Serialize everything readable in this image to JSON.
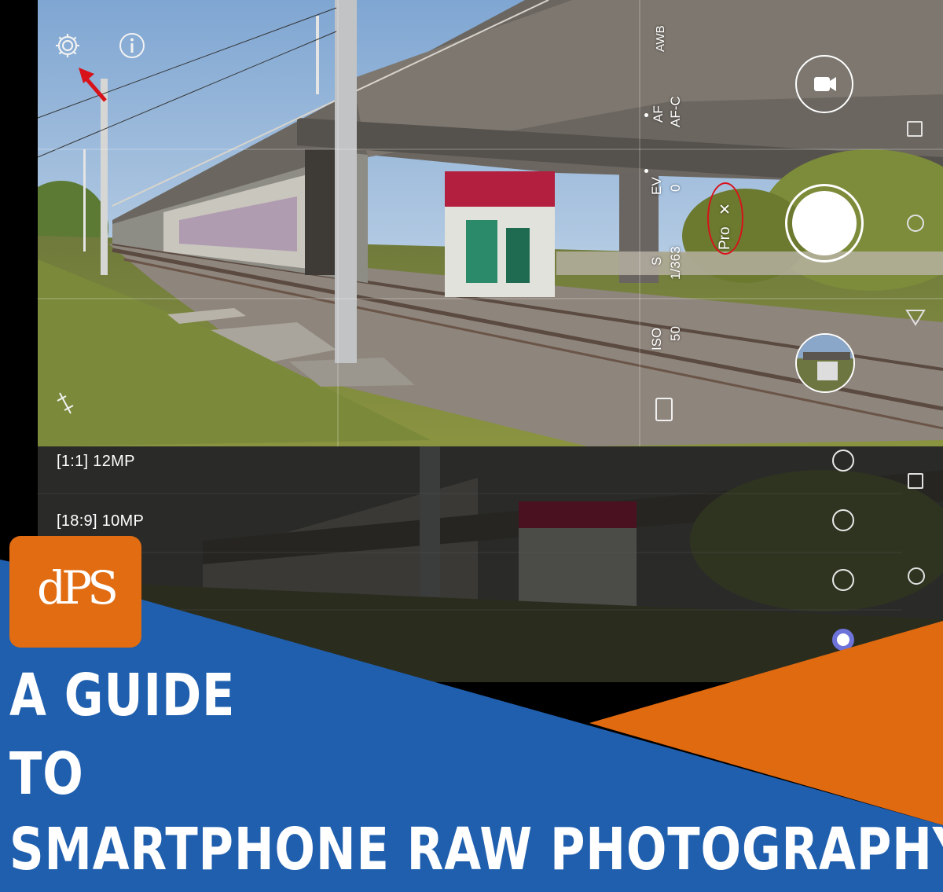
{
  "camera": {
    "settings_icon": "gear-icon",
    "info_icon": "info-icon",
    "annotation_arrow_color": "#d8121a",
    "white_balance": "AWB",
    "af_label": "AF",
    "af_value": "AF-C",
    "ev_label": "EV",
    "ev_value": "0",
    "s_label": "S",
    "s_value": "1/363",
    "iso_label": "ISO",
    "iso_value": "50",
    "mode_label": "Pro",
    "mode_close": "✕",
    "video_icon": "video-camera-icon",
    "shutter_icon": "shutter-button",
    "grid_icon": "leveler-icon"
  },
  "resolution": {
    "options": [
      {
        "label": "[1:1] 12MP",
        "selected": false
      },
      {
        "label": "[18:9] 10MP",
        "selected": false
      },
      {
        "label": "",
        "selected": false
      },
      {
        "label": "",
        "selected": true
      }
    ]
  },
  "banner": {
    "logo_text": "dPS",
    "logo_color": "#e16c12",
    "blue_color": "#1f5fae",
    "orange_color": "#e06a10",
    "line1": "A GUIDE",
    "line2": "TO",
    "line3": "SMARTPHONE RAW PHOTOGRAPHY"
  }
}
